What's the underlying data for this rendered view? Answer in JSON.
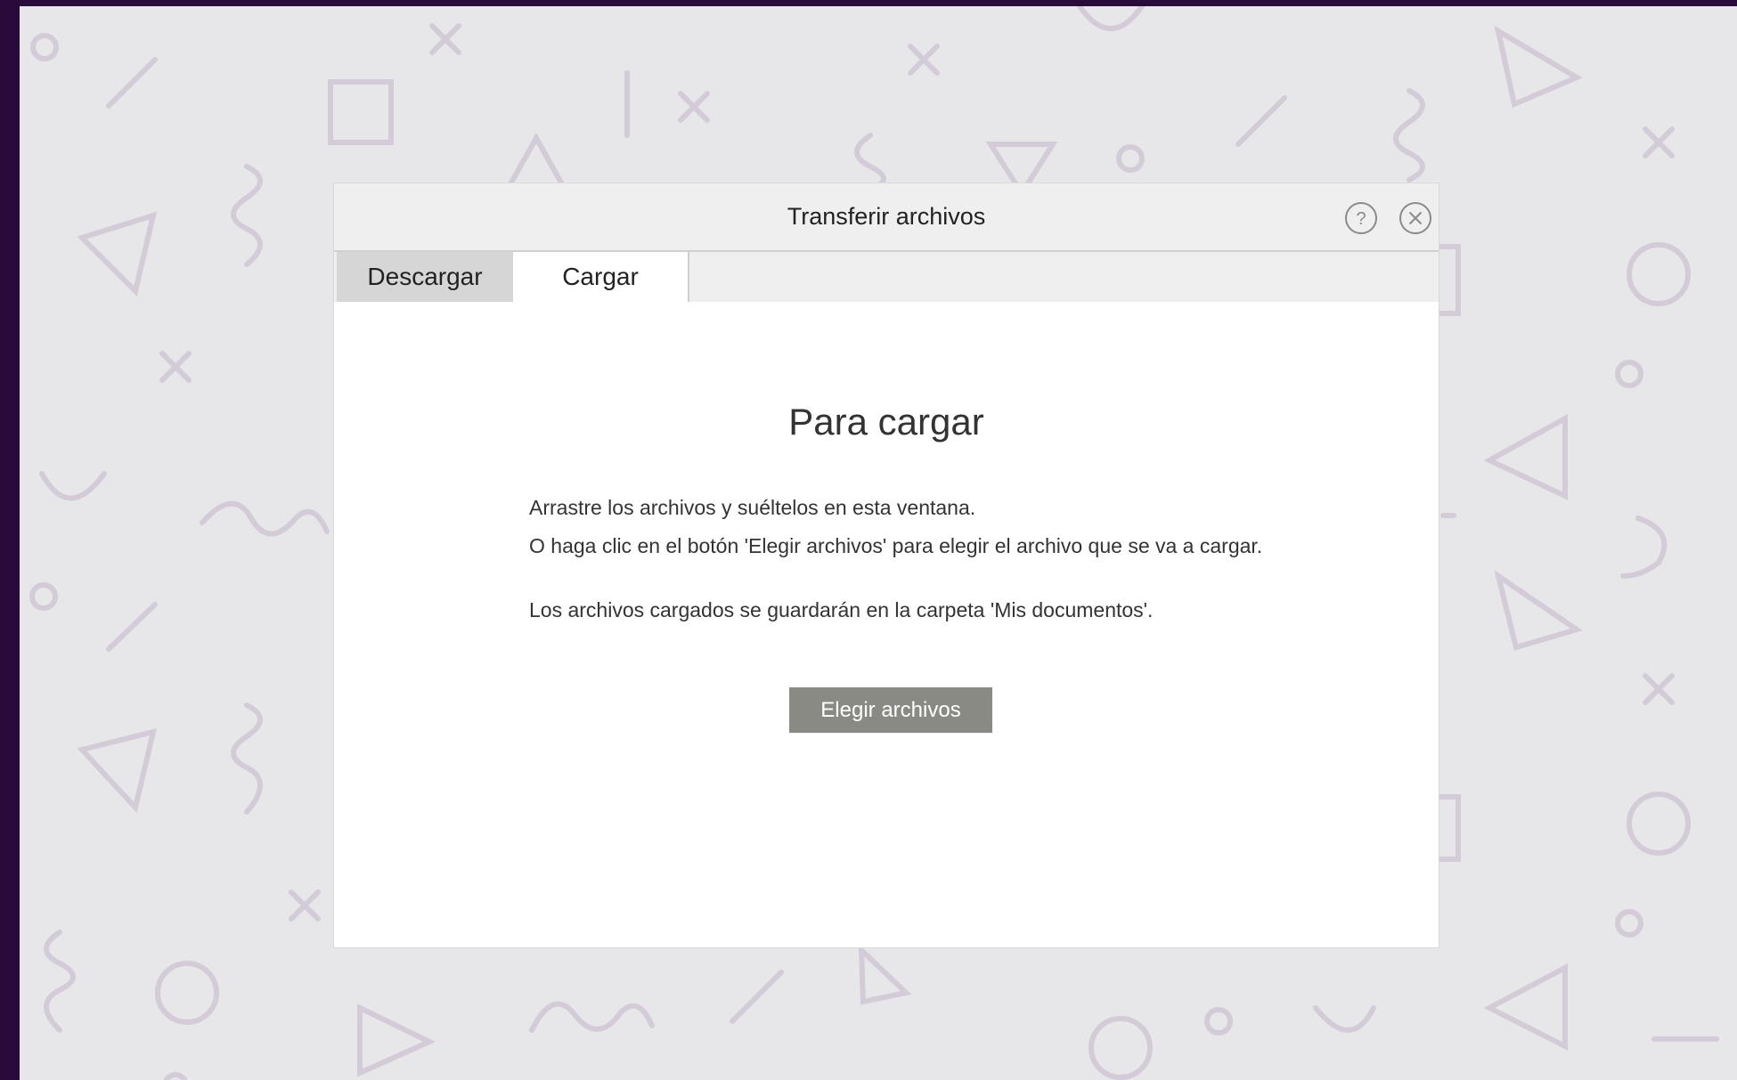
{
  "dialog": {
    "title": "Transferir archivos",
    "help_icon": "help-circle-icon",
    "close_icon": "close-circle-icon"
  },
  "tabs": [
    {
      "label": "Descargar",
      "active": false
    },
    {
      "label": "Cargar",
      "active": true
    }
  ],
  "upload": {
    "heading": "Para cargar",
    "instructions": [
      "Arrastre los archivos y suéltelos en esta ventana.",
      "O haga clic en el botón 'Elegir archivos' para elegir el archivo que se va a cargar.",
      "Los archivos cargados se guardarán en la carpeta 'Mis documentos'."
    ],
    "choose_button": "Elegir archivos"
  },
  "colors": {
    "outer_background": "#2a0a3a",
    "pattern_background": "#e7e6e8",
    "pattern_shapes": "#d3ccd8",
    "button": "#8a8a84"
  }
}
